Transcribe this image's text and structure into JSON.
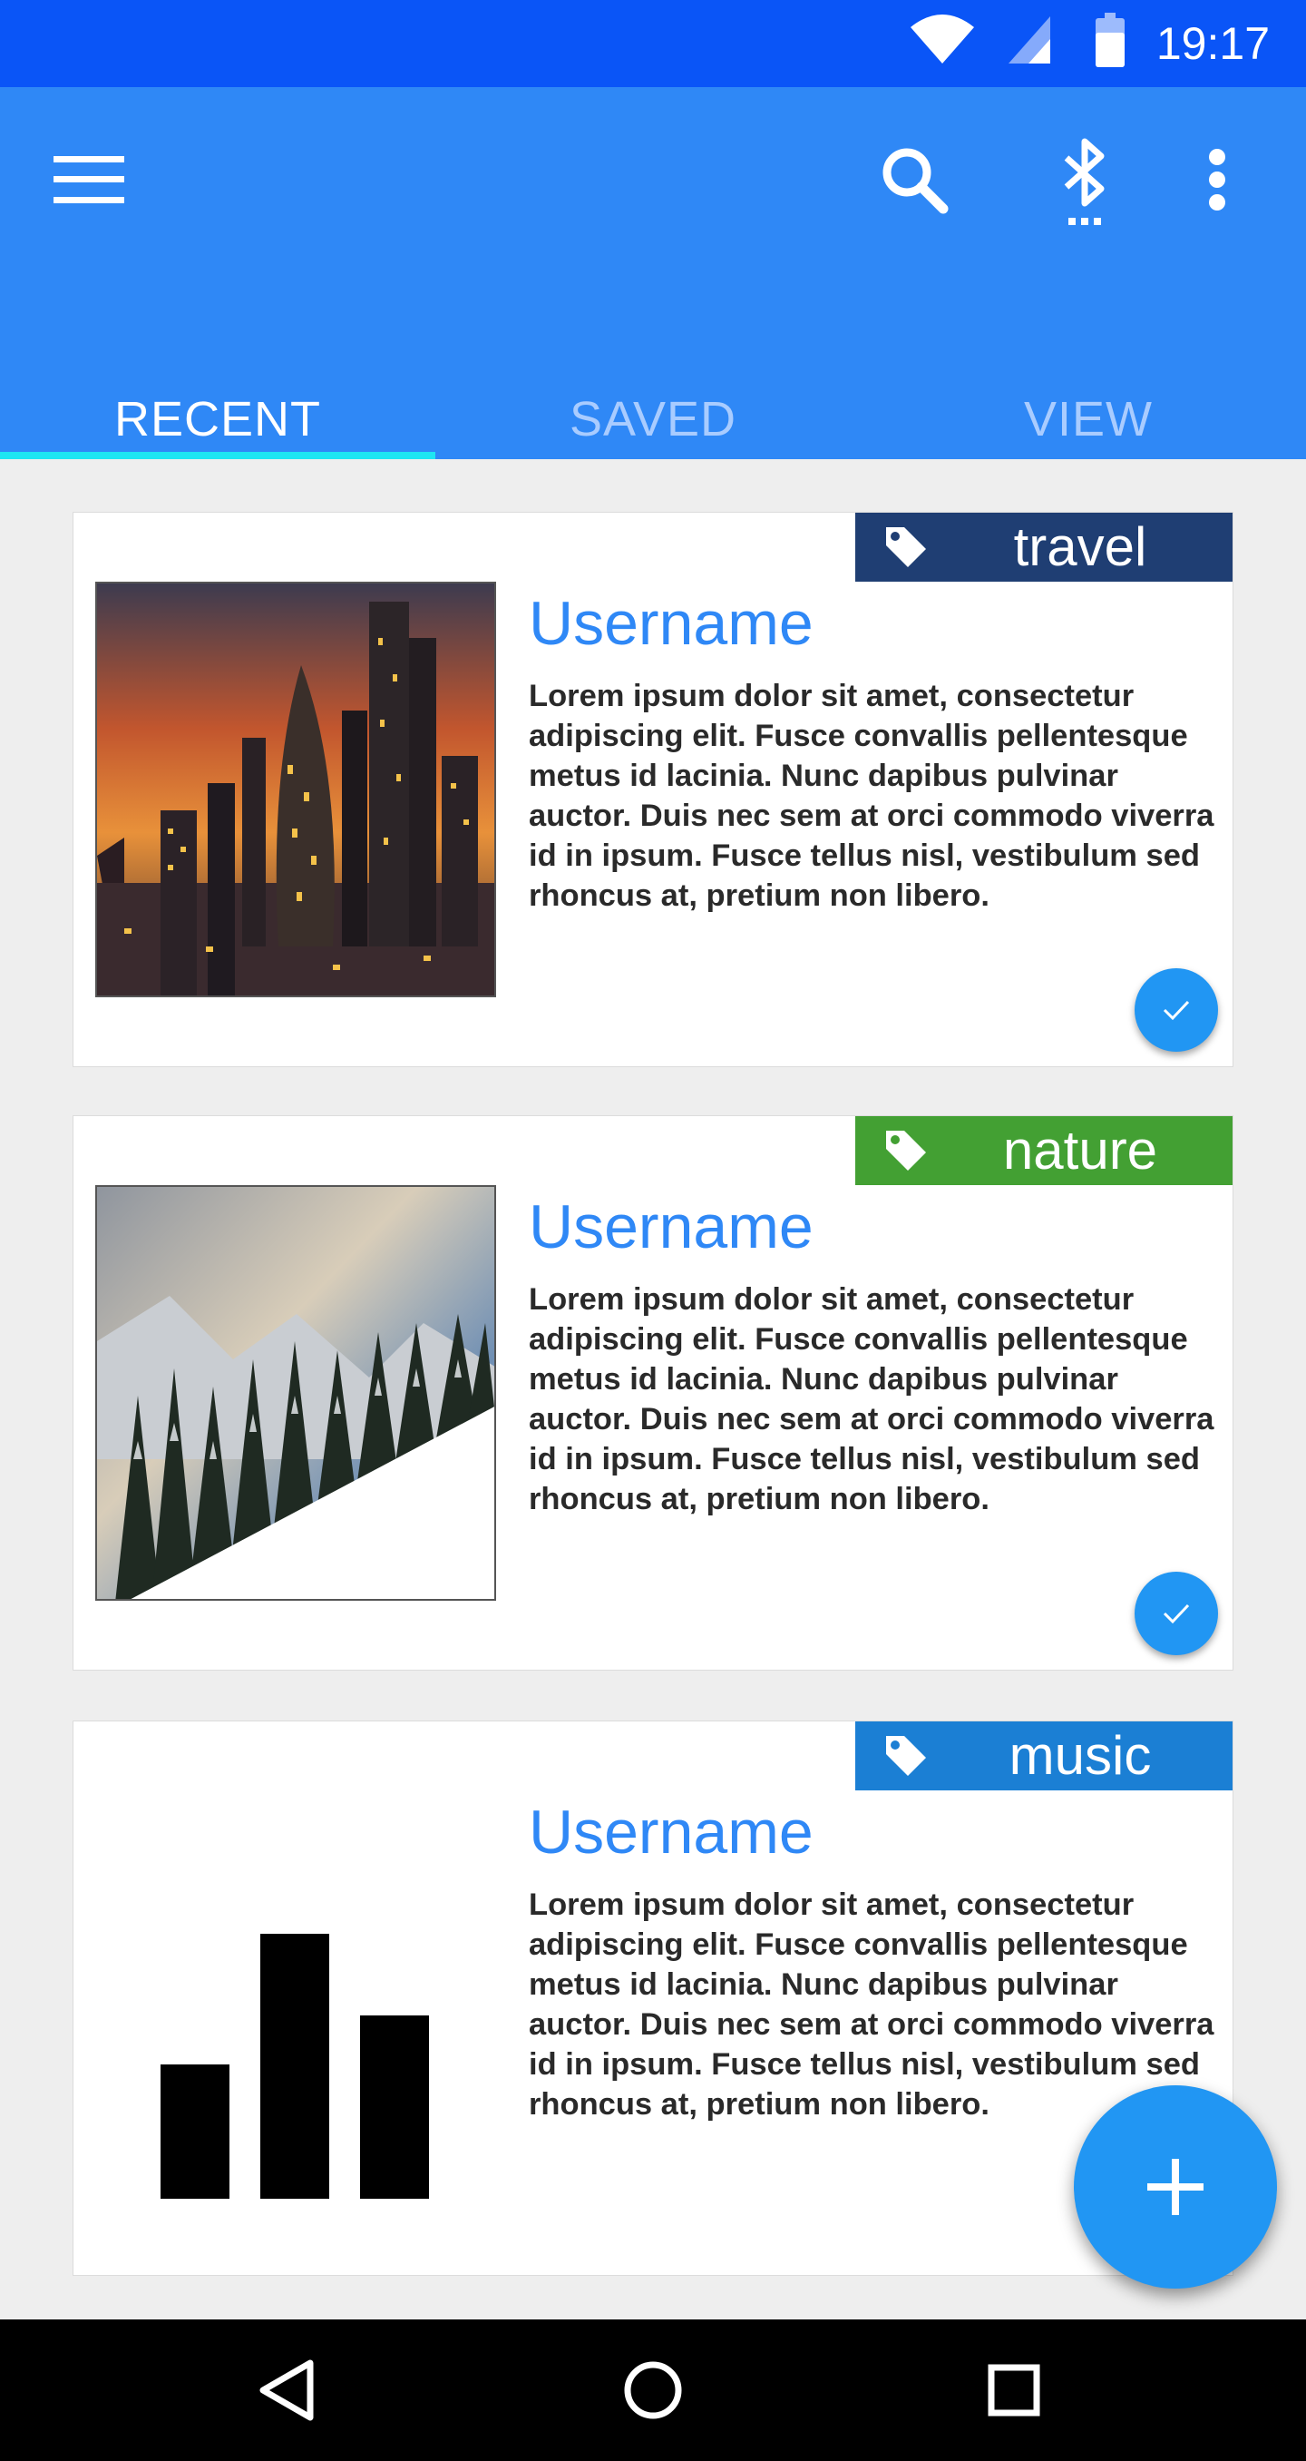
{
  "status_bar": {
    "time": "19:17",
    "icons": [
      "wifi-icon",
      "signal-icon",
      "battery-icon"
    ]
  },
  "app_bar": {
    "icons": [
      "menu-icon",
      "search-icon",
      "bluetooth-icon",
      "more-vert-icon"
    ],
    "colors": {
      "status": "#0a55f7",
      "bar": "#2f88f6",
      "indicator": "#1ee5f2"
    }
  },
  "tabs": [
    {
      "label": "RECENT",
      "active": true
    },
    {
      "label": "SAVED",
      "active": false
    },
    {
      "label": "VIEW",
      "active": false
    }
  ],
  "cards": [
    {
      "tag": "travel",
      "tag_color": "#1f3e73",
      "image": "city-skyline-sunset",
      "username": "Username",
      "text": "Lorem ipsum dolor sit amet, consectetur adipiscing elit. Fusce convallis pellentesque metus id lacinia. Nunc dapibus pulvinar auctor. Duis nec sem at orci commodo viverra id in ipsum. Fusce tellus nisl, vestibulum sed rhoncus at, pretium non libero.",
      "checked": true
    },
    {
      "tag": "nature",
      "tag_color": "#43a033",
      "image": "snowy-forest-mountains",
      "username": "Username",
      "text": "Lorem ipsum dolor sit amet, consectetur adipiscing elit. Fusce convallis pellentesque metus id lacinia. Nunc dapibus pulvinar auctor. Duis nec sem at orci commodo viverra id in ipsum. Fusce tellus nisl, vestibulum sed rhoncus at, pretium non libero.",
      "checked": true
    },
    {
      "tag": "music",
      "tag_color": "#1b7fd4",
      "image": "bar-graph-icon",
      "username": "Username",
      "text": "Lorem ipsum dolor sit amet, consectetur adipiscing elit. Fusce convallis pellentesque metus id lacinia. Nunc dapibus pulvinar auctor. Duis nec sem at orci commodo viverra id in ipsum. Fusce tellus nisl, vestibulum sed rhoncus at, pretium non libero.",
      "checked": false
    }
  ],
  "fab": {
    "icon": "add-icon"
  },
  "nav_bar": {
    "icons": [
      "back-icon",
      "home-icon",
      "recents-icon"
    ]
  }
}
